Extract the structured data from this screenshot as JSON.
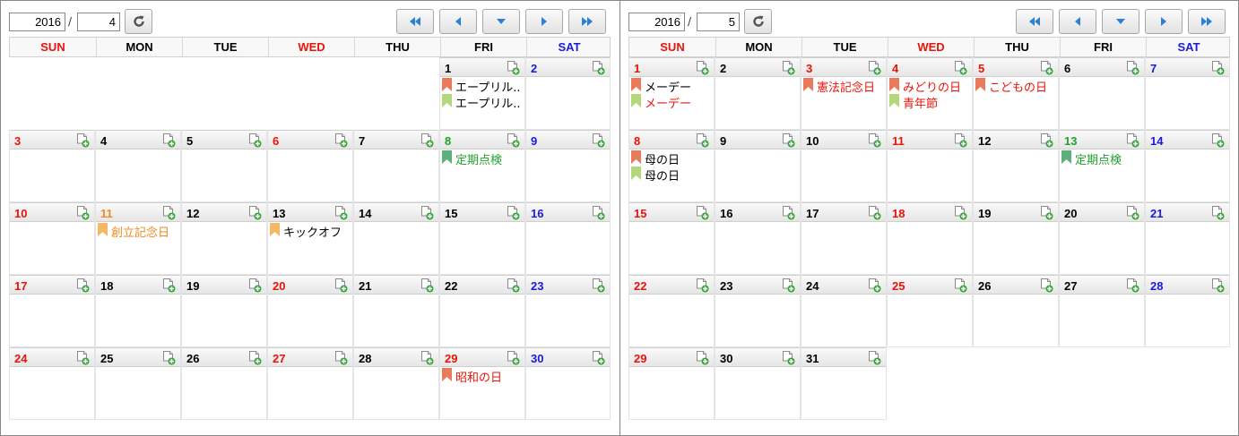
{
  "colors": {
    "sun": "#e8140a",
    "sat": "#1a1ad8",
    "holiday_flag": "#e97a5c",
    "alt_flag": "#b5d77c",
    "check_flag": "#5db07b",
    "orange_flag": "#f5b866"
  },
  "weekday_headers": [
    {
      "label": "SUN",
      "color": "red"
    },
    {
      "label": "MON",
      "color": "black"
    },
    {
      "label": "TUE",
      "color": "black"
    },
    {
      "label": "WED",
      "color": "red"
    },
    {
      "label": "THU",
      "color": "black"
    },
    {
      "label": "FRI",
      "color": "black"
    },
    {
      "label": "SAT",
      "color": "blue"
    }
  ],
  "nav_icons": [
    "double-left-icon",
    "left-icon",
    "down-icon",
    "right-icon",
    "double-right-icon"
  ],
  "calendars": [
    {
      "year": "2016",
      "month": "4",
      "weeks": [
        [
          null,
          null,
          null,
          null,
          null,
          {
            "day": "1",
            "color": "black",
            "events": [
              {
                "text": "エープリル..",
                "flag": "holiday",
                "color": "black"
              },
              {
                "text": "エープリル..",
                "flag": "alt",
                "color": "black"
              }
            ]
          },
          {
            "day": "2",
            "color": "blue",
            "events": []
          }
        ],
        [
          {
            "day": "3",
            "color": "red",
            "events": []
          },
          {
            "day": "4",
            "color": "black",
            "events": []
          },
          {
            "day": "5",
            "color": "black",
            "events": []
          },
          {
            "day": "6",
            "color": "red",
            "events": []
          },
          {
            "day": "7",
            "color": "black",
            "events": []
          },
          {
            "day": "8",
            "color": "green",
            "events": [
              {
                "text": "定期点検",
                "flag": "check",
                "color": "green"
              }
            ]
          },
          {
            "day": "9",
            "color": "blue",
            "events": []
          }
        ],
        [
          {
            "day": "10",
            "color": "red",
            "events": []
          },
          {
            "day": "11",
            "color": "orange",
            "events": [
              {
                "text": "創立記念日",
                "flag": "orange",
                "color": "orange"
              }
            ]
          },
          {
            "day": "12",
            "color": "black",
            "events": []
          },
          {
            "day": "13",
            "color": "black",
            "events": [
              {
                "text": "キックオフ",
                "flag": "orange",
                "color": "black"
              }
            ]
          },
          {
            "day": "14",
            "color": "black",
            "events": []
          },
          {
            "day": "15",
            "color": "black",
            "events": []
          },
          {
            "day": "16",
            "color": "blue",
            "events": []
          }
        ],
        [
          {
            "day": "17",
            "color": "red",
            "events": []
          },
          {
            "day": "18",
            "color": "black",
            "events": []
          },
          {
            "day": "19",
            "color": "black",
            "events": []
          },
          {
            "day": "20",
            "color": "red",
            "events": []
          },
          {
            "day": "21",
            "color": "black",
            "events": []
          },
          {
            "day": "22",
            "color": "black",
            "events": []
          },
          {
            "day": "23",
            "color": "blue",
            "events": []
          }
        ],
        [
          {
            "day": "24",
            "color": "red",
            "events": []
          },
          {
            "day": "25",
            "color": "black",
            "events": []
          },
          {
            "day": "26",
            "color": "black",
            "events": []
          },
          {
            "day": "27",
            "color": "red",
            "events": []
          },
          {
            "day": "28",
            "color": "black",
            "events": []
          },
          {
            "day": "29",
            "color": "red",
            "events": [
              {
                "text": "昭和の日",
                "flag": "holiday",
                "color": "red"
              }
            ]
          },
          {
            "day": "30",
            "color": "blue",
            "events": []
          }
        ]
      ]
    },
    {
      "year": "2016",
      "month": "5",
      "weeks": [
        [
          {
            "day": "1",
            "color": "red",
            "events": [
              {
                "text": "メーデー",
                "flag": "holiday",
                "color": "black"
              },
              {
                "text": "メーデー",
                "flag": "alt",
                "color": "red"
              }
            ]
          },
          {
            "day": "2",
            "color": "black",
            "events": []
          },
          {
            "day": "3",
            "color": "red",
            "events": [
              {
                "text": "憲法記念日",
                "flag": "holiday",
                "color": "red"
              }
            ]
          },
          {
            "day": "4",
            "color": "red",
            "events": [
              {
                "text": "みどりの日",
                "flag": "holiday",
                "color": "red"
              },
              {
                "text": "青年節",
                "flag": "alt",
                "color": "red"
              }
            ]
          },
          {
            "day": "5",
            "color": "red",
            "events": [
              {
                "text": "こどもの日",
                "flag": "holiday",
                "color": "red"
              }
            ]
          },
          {
            "day": "6",
            "color": "black",
            "events": []
          },
          {
            "day": "7",
            "color": "blue",
            "events": []
          }
        ],
        [
          {
            "day": "8",
            "color": "red",
            "events": [
              {
                "text": "母の日",
                "flag": "holiday",
                "color": "black"
              },
              {
                "text": "母の日",
                "flag": "alt",
                "color": "black"
              }
            ]
          },
          {
            "day": "9",
            "color": "black",
            "events": []
          },
          {
            "day": "10",
            "color": "black",
            "events": []
          },
          {
            "day": "11",
            "color": "red",
            "events": []
          },
          {
            "day": "12",
            "color": "black",
            "events": []
          },
          {
            "day": "13",
            "color": "green",
            "events": [
              {
                "text": "定期点検",
                "flag": "check",
                "color": "green"
              }
            ]
          },
          {
            "day": "14",
            "color": "blue",
            "events": []
          }
        ],
        [
          {
            "day": "15",
            "color": "red",
            "events": []
          },
          {
            "day": "16",
            "color": "black",
            "events": []
          },
          {
            "day": "17",
            "color": "black",
            "events": []
          },
          {
            "day": "18",
            "color": "red",
            "events": []
          },
          {
            "day": "19",
            "color": "black",
            "events": []
          },
          {
            "day": "20",
            "color": "black",
            "events": []
          },
          {
            "day": "21",
            "color": "blue",
            "events": []
          }
        ],
        [
          {
            "day": "22",
            "color": "red",
            "events": []
          },
          {
            "day": "23",
            "color": "black",
            "events": []
          },
          {
            "day": "24",
            "color": "black",
            "events": []
          },
          {
            "day": "25",
            "color": "red",
            "events": []
          },
          {
            "day": "26",
            "color": "black",
            "events": []
          },
          {
            "day": "27",
            "color": "black",
            "events": []
          },
          {
            "day": "28",
            "color": "blue",
            "events": []
          }
        ],
        [
          {
            "day": "29",
            "color": "red",
            "events": []
          },
          {
            "day": "30",
            "color": "black",
            "events": []
          },
          {
            "day": "31",
            "color": "black",
            "events": []
          },
          null,
          null,
          null,
          null
        ]
      ]
    }
  ]
}
